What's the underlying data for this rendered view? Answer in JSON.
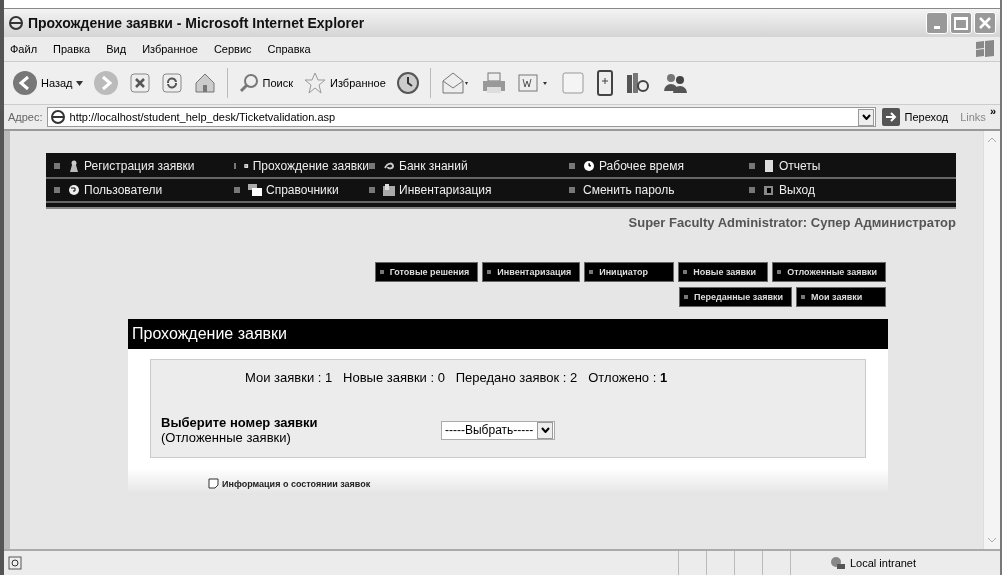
{
  "window": {
    "title": "Прохождение заявки - Microsoft Internet Explorer"
  },
  "menu": [
    "Файл",
    "Правка",
    "Вид",
    "Избранное",
    "Сервис",
    "Справка"
  ],
  "toolbar": {
    "back": "Назад",
    "search": "Поиск",
    "favorites": "Избранное"
  },
  "address_bar": {
    "label": "Адрес:",
    "url": "http://localhost/student_help_desk/Ticketvalidation.asp",
    "go": "Переход",
    "links": "Links",
    "more": "»"
  },
  "nav": [
    [
      "Регистрация заявки",
      "Прохождение заявки",
      "Банк знаний",
      "Рабочее время",
      "Отчеты"
    ],
    [
      "Пользователи",
      "Справочники",
      "Инвентаризация",
      "Сменить пароль",
      "Выход"
    ]
  ],
  "user": "Super Faculty Administrator: Супер Администратор",
  "sub_buttons": [
    [
      "Готовые решения",
      "Инвентаризация",
      "Инициатор",
      "Новые заявки",
      "Отложенные заявки"
    ],
    [
      "Переданные заявки",
      "Мои заявки"
    ]
  ],
  "section_title": "Прохождение заявки",
  "stats": "Мои заявки : 1   Новые заявки : 0   Передано заявок : 2   Отложено : **1**",
  "ticket": {
    "label": "Выберите номер заявки",
    "sublabel": "(Отложенные заявки)",
    "select": "-----Выбрать-----"
  },
  "footer_link": "Информация о состоянии заявок",
  "status_bar": {
    "zone": "Local intranet"
  }
}
